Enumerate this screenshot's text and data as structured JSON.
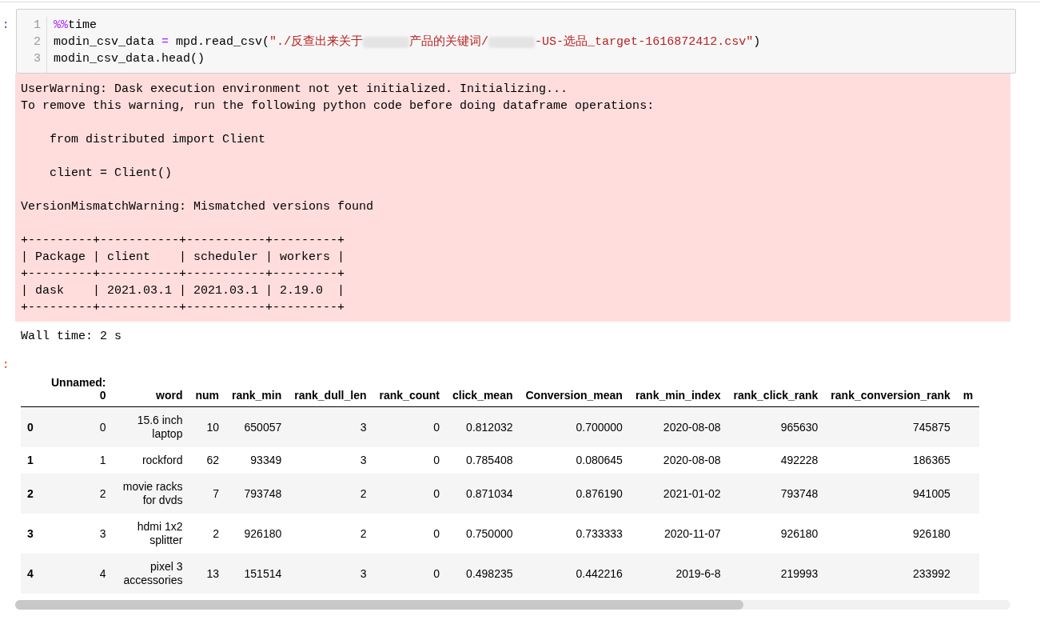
{
  "input_cell": {
    "prompt": ":",
    "lines": [
      {
        "number": "1",
        "tokens": [
          {
            "kind": "magic",
            "text": "%%"
          },
          {
            "kind": "plain",
            "text": "time"
          }
        ]
      },
      {
        "number": "2",
        "tokens": [
          {
            "kind": "plain",
            "text": "modin_csv_data "
          },
          {
            "kind": "operator",
            "text": "="
          },
          {
            "kind": "plain",
            "text": " mpd.read_csv("
          },
          {
            "kind": "string",
            "text": "\"./反查出来关于"
          },
          {
            "kind": "redacted"
          },
          {
            "kind": "string",
            "text": "产品的关键词/"
          },
          {
            "kind": "redacted"
          },
          {
            "kind": "string",
            "text": "-US-选品_target-1616872412.csv\""
          },
          {
            "kind": "plain",
            "text": ")"
          }
        ]
      },
      {
        "number": "3",
        "tokens": [
          {
            "kind": "plain",
            "text": "modin_csv_data.head()"
          }
        ]
      }
    ]
  },
  "stderr": "UserWarning: Dask execution environment not yet initialized. Initializing...\nTo remove this warning, run the following python code before doing dataframe operations:\n\n    from distributed import Client\n\n    client = Client()\n\nVersionMismatchWarning: Mismatched versions found\n\n+---------+-----------+-----------+---------+\n| Package | client    | scheduler | workers |\n+---------+-----------+-----------+---------+\n| dask    | 2021.03.1 | 2021.03.1 | 2.19.0  |\n+---------+-----------+-----------+---------+",
  "stdout": "Wall time: 2 s",
  "output_prompt": ":",
  "table": {
    "columns": [
      "",
      "Unnamed: 0",
      "word",
      "num",
      "rank_min",
      "rank_dull_len",
      "rank_count",
      "click_mean",
      "Conversion_mean",
      "rank_min_index",
      "rank_click_rank",
      "rank_conversion_rank",
      "m"
    ],
    "rows": [
      [
        "0",
        "0",
        "15.6 inch laptop",
        "10",
        "650057",
        "3",
        "0",
        "0.812032",
        "0.700000",
        "2020-08-08",
        "965630",
        "745875"
      ],
      [
        "1",
        "1",
        "rockford",
        "62",
        "93349",
        "3",
        "0",
        "0.785408",
        "0.080645",
        "2020-08-08",
        "492228",
        "186365"
      ],
      [
        "2",
        "2",
        "movie racks for dvds",
        "7",
        "793748",
        "2",
        "0",
        "0.871034",
        "0.876190",
        "2021-01-02",
        "793748",
        "941005"
      ],
      [
        "3",
        "3",
        "hdmi 1x2 splitter",
        "2",
        "926180",
        "2",
        "0",
        "0.750000",
        "0.733333",
        "2020-11-07",
        "926180",
        "926180"
      ],
      [
        "4",
        "4",
        "pixel 3 accessories",
        "13",
        "151514",
        "3",
        "0",
        "0.498235",
        "0.442216",
        "2019-6-8",
        "219993",
        "233992"
      ]
    ]
  }
}
